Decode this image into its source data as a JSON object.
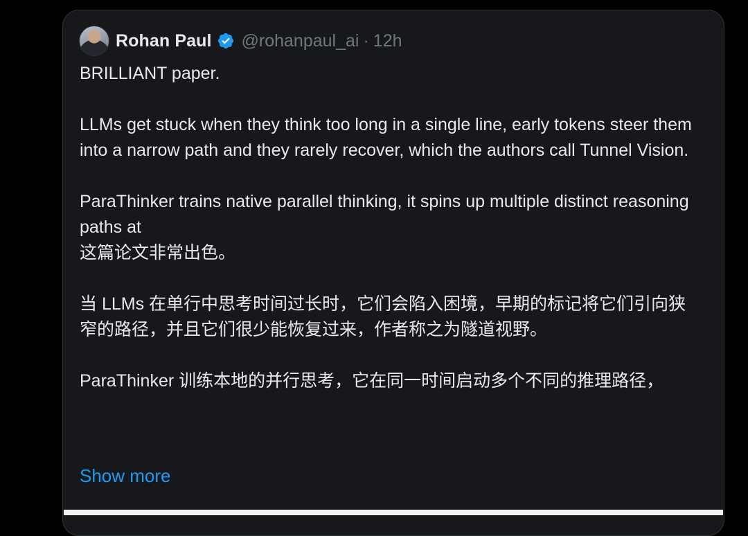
{
  "tweet": {
    "author_name": "Rohan Paul",
    "handle": "@rohanpaul_ai",
    "separator": "·",
    "time": "12h",
    "paragraphs_en": [
      "BRILLIANT paper.",
      "LLMs get stuck when they think too long in a single line, early tokens steer them into a narrow path and they rarely recover, which the authors call Tunnel Vision.",
      "ParaThinker trains native parallel thinking, it spins up multiple distinct reasoning paths at"
    ],
    "paragraphs_zh": [
      "这篇论文非常出色。",
      "当 LLMs 在单行中思考时间过长时，它们会陷入困境，早期的标记将它们引向狭窄的路径，并且它们很少能恢复过来，作者称之为隧道视野。",
      "ParaThinker 训练本地的并行思考，它在同一时间启动多个不同的推理路径，"
    ],
    "show_more": "Show more"
  },
  "icons": {
    "avatar": "profile-photo",
    "verified": "verified-badge-icon"
  },
  "colors": {
    "background": "#000000",
    "card": "#16181c",
    "text": "#e7e9ea",
    "muted": "#71767b",
    "link": "#1d9bf0",
    "verified": "#1d9bf0"
  }
}
